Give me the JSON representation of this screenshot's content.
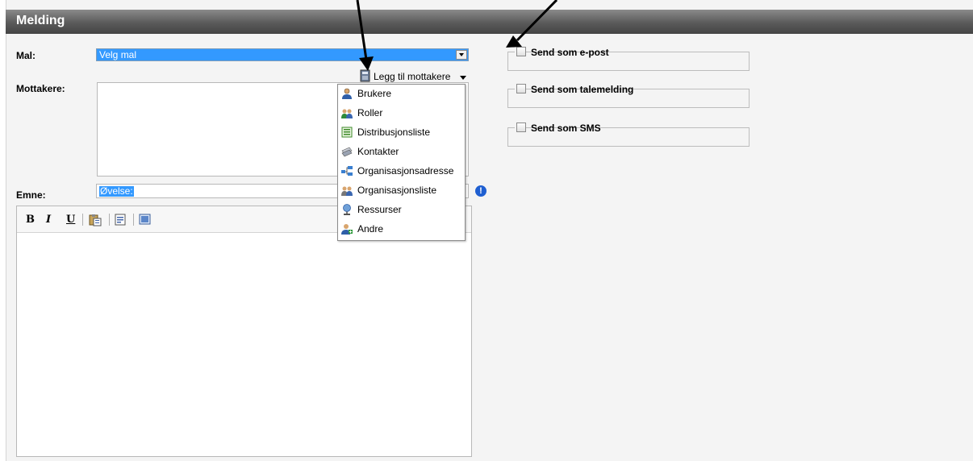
{
  "panel": {
    "title": "Melding"
  },
  "labels": {
    "mal": "Mal:",
    "mottakere": "Mottakere:",
    "emne": "Emne:"
  },
  "template_select": {
    "selected": "Velg mal"
  },
  "add_recipients": {
    "label": "Legg til mottakere"
  },
  "subject": {
    "value": "Øvelse:"
  },
  "info_badge": {
    "glyph": "!"
  },
  "recipient_menu": {
    "items": [
      {
        "label": "Brukere",
        "icon": "user-icon"
      },
      {
        "label": "Roller",
        "icon": "roles-icon"
      },
      {
        "label": "Distribusjonsliste",
        "icon": "list-icon"
      },
      {
        "label": "Kontakter",
        "icon": "contacts-icon"
      },
      {
        "label": "Organisasjonsadresse",
        "icon": "org-address-icon"
      },
      {
        "label": "Organisasjonsliste",
        "icon": "org-list-icon"
      },
      {
        "label": "Ressurser",
        "icon": "resource-icon"
      },
      {
        "label": "Andre",
        "icon": "add-user-icon"
      }
    ]
  },
  "editor_toolbar": {
    "bold": "B",
    "italic": "I",
    "underline": "U"
  },
  "send_options": [
    {
      "label": "Send som e-post",
      "checked": false
    },
    {
      "label": "Send som talemelding",
      "checked": false
    },
    {
      "label": "Send som SMS",
      "checked": false
    }
  ],
  "colors": {
    "accent": "#3399ff",
    "titlebar": "#5a5a5a",
    "info": "#1f5fd1"
  }
}
